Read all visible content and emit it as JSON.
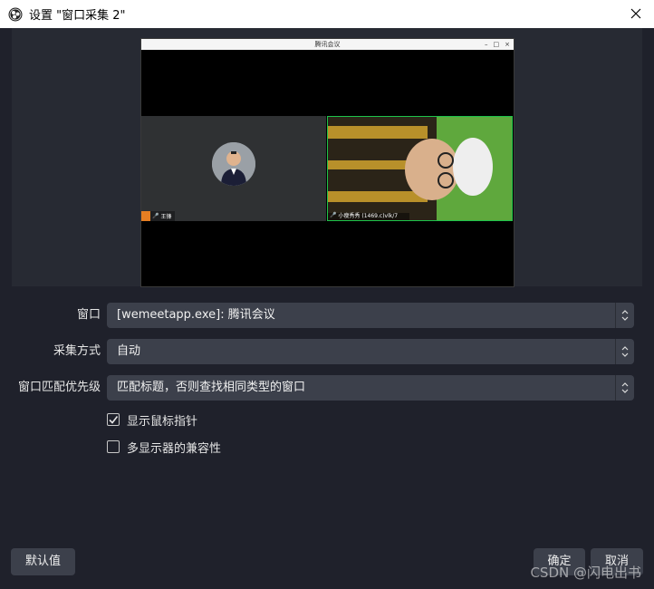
{
  "window": {
    "title": "设置 \"窗口采集 2\"",
    "close_icon": "close-icon"
  },
  "preview": {
    "captured_window_title": "腾讯会议",
    "left_participant_name": "王锋",
    "right_participant_name": "小瘦秀秀 (1469.c)vlk/7"
  },
  "form": {
    "window_label": "窗口",
    "window_value": "[wemeetapp.exe]: 腾讯会议",
    "capture_method_label": "采集方式",
    "capture_method_value": "自动",
    "match_priority_label": "窗口匹配优先级",
    "match_priority_value": "匹配标题，否则查找相同类型的窗口"
  },
  "options": {
    "show_cursor_label": "显示鼠标指针",
    "show_cursor_checked": true,
    "multi_display_label": "多显示器的兼容性",
    "multi_display_checked": false
  },
  "buttons": {
    "defaults": "默认值",
    "ok": "确定",
    "cancel": "取消"
  },
  "watermark": "CSDN @闪电出书",
  "colors": {
    "background": "#1f212b",
    "preview_bg": "#272a33",
    "control_bg": "#3c404b",
    "green_screen": "#5a9d3a",
    "active_border": "#1ec34a"
  }
}
